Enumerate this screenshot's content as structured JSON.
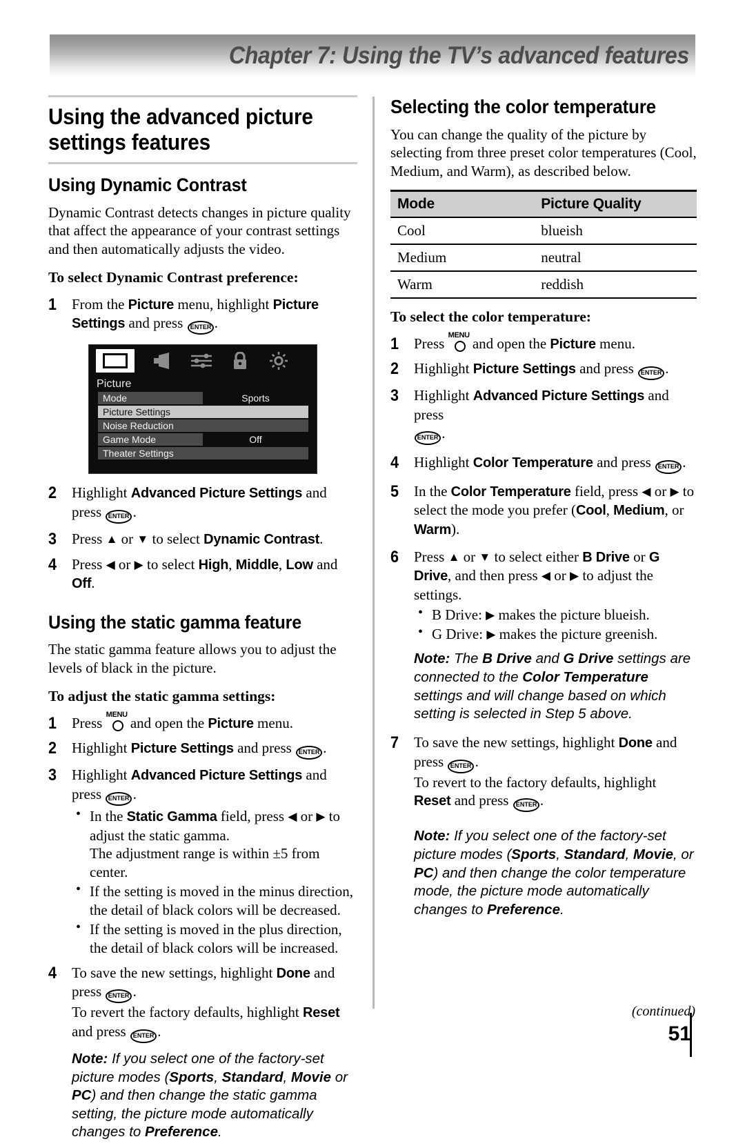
{
  "header": {
    "chapter_title": "Chapter 7: Using the TV’s advanced features"
  },
  "footer": {
    "continued": "(continued)",
    "page_number": "51"
  },
  "left": {
    "section_title": "Using the advanced picture settings features",
    "dynamic": {
      "heading": "Using Dynamic Contrast",
      "body": "Dynamic Contrast detects changes in picture quality that affect the appearance of your contrast settings and then automatically adjusts the video.",
      "proc_title": "To select Dynamic Contrast preference:",
      "step1_a": "From the ",
      "step1_picture": "Picture",
      "step1_b": " menu, highlight ",
      "step1_settings": "Picture Settings",
      "step1_c": " and press ",
      "step2_a": "Highlight ",
      "step2_adv": "Advanced Picture Settings",
      "step2_b": " and press ",
      "step3_a": "Press ",
      "step3_b": " or ",
      "step3_c": " to select ",
      "step3_dc": "Dynamic Contrast",
      "step4_a": "Press ",
      "step4_b": " or ",
      "step4_c": " to select ",
      "step4_high": "High",
      "step4_middle": "Middle",
      "step4_low": "Low",
      "step4_and": " and ",
      "step4_off": "Off"
    },
    "osd": {
      "menu_title": "Picture",
      "icons": [
        "picture-icon",
        "speaker-icon",
        "sliders-icon",
        "lock-icon",
        "brightness-icon"
      ],
      "rows": [
        {
          "label": "Mode",
          "value": "Sports",
          "highlight": false,
          "split": true
        },
        {
          "label": "Picture Settings",
          "value": "",
          "highlight": true,
          "split": false
        },
        {
          "label": "Noise Reduction",
          "value": "",
          "highlight": false,
          "split": false
        },
        {
          "label": "Game Mode",
          "value": "Off",
          "highlight": false,
          "split": true
        },
        {
          "label": "Theater Settings",
          "value": "",
          "highlight": false,
          "split": false
        }
      ]
    },
    "gamma": {
      "heading": "Using the static gamma feature",
      "body": "The static gamma feature allows you to adjust the levels of black in the picture.",
      "proc_title": "To adjust the static gamma settings:",
      "step1_a": "Press ",
      "step1_b": " and open the ",
      "step1_picture": "Picture",
      "step1_c": " menu.",
      "step2_a": "Highlight ",
      "step2_settings": "Picture Settings",
      "step2_b": " and press ",
      "step3_a": "Highlight ",
      "step3_adv": "Advanced Picture Settings",
      "step3_b": " and press ",
      "bullet1_a": "In the ",
      "bullet1_sg": "Static Gamma",
      "bullet1_b": " field, press ",
      "bullet1_c": " or ",
      "bullet1_d": " to adjust the static gamma.",
      "bullet1_e": "The adjustment range is within ±5 from center.",
      "bullet2": "If the setting is moved in the minus direction, the detail of black colors will be decreased.",
      "bullet3": "If the setting is moved in the plus direction, the detail of black colors will be increased.",
      "step4_a": "To save the new settings, highlight ",
      "step4_done": "Done",
      "step4_b": " and press ",
      "step4_c": "To revert the factory defaults, highlight ",
      "step4_reset": "Reset",
      "step4_d": " and press "
    },
    "note": {
      "label": "Note:",
      "a": " If you select one of the factory-set picture modes (",
      "m1": "Sports",
      "s1": ", ",
      "m2": "Standard",
      "s2": ", ",
      "m3": "Movie",
      "s3": " or ",
      "m4": "PC",
      "b": ") and then change the static gamma setting, the picture mode automatically changes to ",
      "pref": "Preference",
      "c": "."
    }
  },
  "right": {
    "section_title": "Selecting the color temperature",
    "body": "You can change the quality of the picture by selecting from three preset color temperatures (Cool, Medium, and Warm), as described below.",
    "table": {
      "headers": [
        "Mode",
        "Picture Quality"
      ],
      "rows": [
        [
          "Cool",
          "blueish"
        ],
        [
          "Medium",
          "neutral"
        ],
        [
          "Warm",
          "reddish"
        ]
      ]
    },
    "proc_title": "To select the color temperature:",
    "steps": {
      "step1_a": "Press ",
      "step1_b": " and open the ",
      "step1_picture": "Picture",
      "step1_c": " menu.",
      "step2_a": "Highlight ",
      "step2_settings": "Picture Settings",
      "step2_b": " and press ",
      "step3_a": "Highlight ",
      "step3_adv": "Advanced Picture Settings",
      "step3_b": " and press ",
      "step4_a": "Highlight ",
      "step4_ct": "Color Temperature",
      "step4_b": " and press ",
      "step5_a": "In the ",
      "step5_ct": "Color Temperature",
      "step5_b": " field, press ",
      "step5_c": " or ",
      "step5_d": " to select the mode you prefer (",
      "step5_cool": "Cool",
      "step5_s1": ", ",
      "step5_medium": "Medium",
      "step5_s2": ", or ",
      "step5_warm": "Warm",
      "step5_e": ").",
      "step6_a": "Press ",
      "step6_b": " or ",
      "step6_c": " to select either ",
      "step6_bd": "B Drive",
      "step6_d": " or ",
      "step6_gd": "G Drive",
      "step6_e": ", and then press ",
      "step6_f": " or ",
      "step6_g": " to adjust the settings.",
      "bullet1_a": "B Drive: ",
      "bullet1_b": " makes the picture blueish.",
      "bullet2_a": "G Drive: ",
      "bullet2_b": " makes the picture greenish.",
      "step7_a": "To save the new settings, highlight ",
      "step7_done": "Done",
      "step7_b": " and press ",
      "step7_c": "To revert to the factory defaults, highlight ",
      "step7_reset": "Reset",
      "step7_d": " and press "
    },
    "note1": {
      "label": "Note:",
      "a": " The ",
      "bd": "B Drive",
      "b": " and ",
      "gd": "G Drive",
      "c": " settings are connected to the ",
      "ct": "Color Temperature",
      "d": " settings and will change based on which setting is selected in Step 5 above."
    },
    "note2": {
      "label": "Note:",
      "a": " If you select one of the factory-set picture modes (",
      "m1": "Sports",
      "s1": ", ",
      "m2": "Standard",
      "s2": ", ",
      "m3": "Movie",
      "s3": ", or ",
      "m4": "PC",
      "b": ") and then change the color temperature mode, the picture mode automatically changes to ",
      "pref": "Preference",
      "c": "."
    }
  },
  "glyphs": {
    "enter_key": "ENTER",
    "menu_key": "MENU",
    "arrow_up": "▲",
    "arrow_down": "▼",
    "arrow_left": "◀",
    "arrow_right": "▶"
  }
}
